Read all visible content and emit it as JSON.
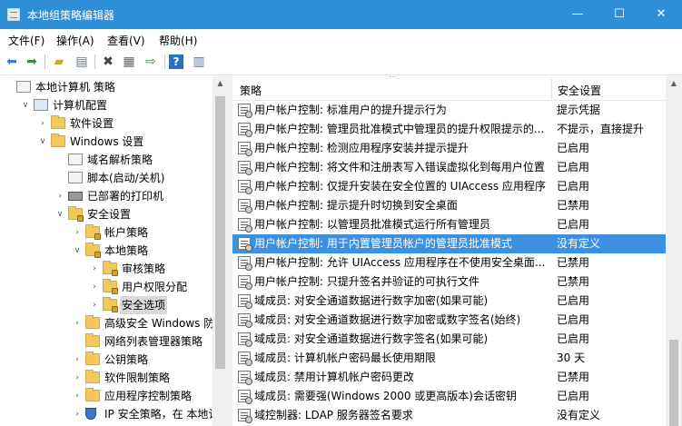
{
  "window": {
    "title": "本地组策略编辑器",
    "controls": {
      "minimize": "—",
      "maximize": "☐",
      "close": "✕"
    }
  },
  "menu": [
    "文件(F)",
    "操作(A)",
    "查看(V)",
    "帮助(H)"
  ],
  "toolbar": {
    "icons": [
      "back-arrow-icon",
      "forward-arrow-icon",
      "up-folder-icon",
      "show-tree-icon",
      "delete-icon",
      "properties-icon",
      "export-list-icon",
      "help-icon",
      "view-icon"
    ]
  },
  "tree": {
    "nodes": [
      {
        "label": "本地计算机 策略",
        "indent": 0,
        "icon": "policy-icon",
        "chevron": ""
      },
      {
        "label": "计算机配置",
        "indent": 1,
        "icon": "computer-icon",
        "chevron": "∨"
      },
      {
        "label": "软件设置",
        "indent": 2,
        "icon": "folder-icon",
        "chevron": "›"
      },
      {
        "label": "Windows 设置",
        "indent": 2,
        "icon": "folder-icon",
        "chevron": "∨"
      },
      {
        "label": "域名解析策略",
        "indent": 3,
        "icon": "doc-icon",
        "chevron": ""
      },
      {
        "label": "脚本(启动/关机)",
        "indent": 3,
        "icon": "doc-icon",
        "chevron": ""
      },
      {
        "label": "已部署的打印机",
        "indent": 3,
        "icon": "printer-icon",
        "chevron": "›"
      },
      {
        "label": "安全设置",
        "indent": 3,
        "icon": "lock-folder-icon",
        "chevron": "∨"
      },
      {
        "label": "帐户策略",
        "indent": 4,
        "icon": "lock-folder-icon",
        "chevron": "›"
      },
      {
        "label": "本地策略",
        "indent": 4,
        "icon": "lock-folder-icon",
        "chevron": "∨"
      },
      {
        "label": "审核策略",
        "indent": 5,
        "icon": "lock-folder-icon",
        "chevron": "›"
      },
      {
        "label": "用户权限分配",
        "indent": 5,
        "icon": "lock-folder-icon",
        "chevron": "›"
      },
      {
        "label": "安全选项",
        "indent": 5,
        "icon": "lock-folder-icon",
        "chevron": "›",
        "selected": true
      },
      {
        "label": "高级安全 Windows 防火",
        "indent": 4,
        "icon": "folder-icon",
        "chevron": "›"
      },
      {
        "label": "网络列表管理器策略",
        "indent": 4,
        "icon": "folder-icon",
        "chevron": ""
      },
      {
        "label": "公钥策略",
        "indent": 4,
        "icon": "folder-icon",
        "chevron": "›"
      },
      {
        "label": "软件限制策略",
        "indent": 4,
        "icon": "folder-icon",
        "chevron": "›"
      },
      {
        "label": "应用程序控制策略",
        "indent": 4,
        "icon": "folder-icon",
        "chevron": "›"
      },
      {
        "label": "IP 安全策略，在 本地计算",
        "indent": 4,
        "icon": "shield-icon",
        "chevron": "›"
      }
    ]
  },
  "list": {
    "columns": [
      "策略",
      "安全设置"
    ],
    "rows": [
      {
        "policy": "用户帐户控制: 标准用户的提升提示行为",
        "setting": "提示凭据"
      },
      {
        "policy": "用户帐户控制: 管理员批准模式中管理员的提升权限提示的...",
        "setting": "不提示，直接提升"
      },
      {
        "policy": "用户帐户控制: 检测应用程序安装并提示提升",
        "setting": "已启用"
      },
      {
        "policy": "用户帐户控制: 将文件和注册表写入错误虚拟化到每用户位置",
        "setting": "已启用"
      },
      {
        "policy": "用户帐户控制: 仅提升安装在安全位置的 UIAccess 应用程序",
        "setting": "已启用"
      },
      {
        "policy": "用户帐户控制: 提示提升时切换到安全桌面",
        "setting": "已禁用"
      },
      {
        "policy": "用户帐户控制: 以管理员批准模式运行所有管理员",
        "setting": "已启用"
      },
      {
        "policy": "用户帐户控制: 用于内置管理员帐户的管理员批准模式",
        "setting": "没有定义",
        "selected": true
      },
      {
        "policy": "用户帐户控制: 允许 UIAccess 应用程序在不使用安全桌面...",
        "setting": "已禁用"
      },
      {
        "policy": "用户帐户控制: 只提升签名并验证的可执行文件",
        "setting": "已禁用"
      },
      {
        "policy": "域成员: 对安全通道数据进行数字加密(如果可能)",
        "setting": "已启用"
      },
      {
        "policy": "域成员: 对安全通道数据进行数字加密或数字签名(始终)",
        "setting": "已启用"
      },
      {
        "policy": "域成员: 对安全通道数据进行数字签名(如果可能)",
        "setting": "已启用"
      },
      {
        "policy": "域成员: 计算机帐户密码最长使用期限",
        "setting": "30 天"
      },
      {
        "policy": "域成员: 禁用计算机帐户密码更改",
        "setting": "已禁用"
      },
      {
        "policy": "域成员: 需要强(Windows 2000 或更高版本)会话密钥",
        "setting": "已启用"
      },
      {
        "policy": "域控制器: LDAP 服务器签名要求",
        "setting": "没有定义"
      }
    ]
  }
}
